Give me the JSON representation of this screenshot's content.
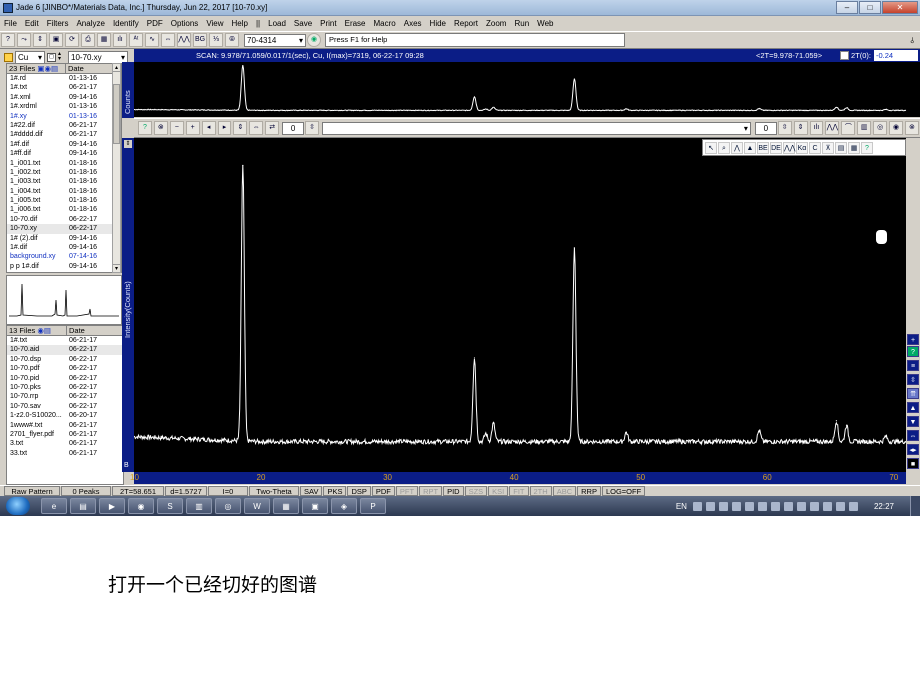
{
  "window": {
    "title": "Jade 6 [JINBO*/Materials Data, Inc.] Thursday, Jun 22, 2017 [10-70.xy]",
    "min": "–",
    "max": "□",
    "close": "✕"
  },
  "menu": [
    "File",
    "Edit",
    "Filters",
    "Analyze",
    "Identify",
    "PDF",
    "Options",
    "View",
    "Help",
    "||",
    "Load",
    "Save",
    "Print",
    "Erase",
    "Macro",
    "Axes",
    "Hide",
    "Report",
    "Zoom",
    "Run",
    "Web"
  ],
  "toolbar": {
    "pdf_number": "70-4314",
    "help_text": "Press F1 for Help",
    "buttons": [
      "?",
      "⤳",
      "⇕",
      "▣",
      "⟳",
      "⎙",
      "▦",
      "ılı",
      "ᴬᵗ",
      "∿",
      "⇔",
      "⋀⋀",
      "BG",
      "⅓",
      "⦾"
    ]
  },
  "left": {
    "filter": "Cu",
    "current_file": "10-70.xy",
    "top_list": {
      "header_files": "23 Files",
      "header_date": "Date",
      "rows": [
        {
          "name": "1#.rd",
          "date": "01-13-16"
        },
        {
          "name": "1#.txt",
          "date": "06-21-17"
        },
        {
          "name": "1#.xml",
          "date": "09-14-16"
        },
        {
          "name": "1#.xrdml",
          "date": "01-13-16"
        },
        {
          "name": "1#.xy",
          "date": "01-13-16",
          "blue": true
        },
        {
          "name": "1#22.dif",
          "date": "06-21-17"
        },
        {
          "name": "1#dddd.dif",
          "date": "06-21-17"
        },
        {
          "name": "1#f.dif",
          "date": "09-14-16"
        },
        {
          "name": "1#ff.dif",
          "date": "09-14-16"
        },
        {
          "name": "1_i001.txt",
          "date": "01-18-16"
        },
        {
          "name": "1_i002.txt",
          "date": "01-18-16"
        },
        {
          "name": "1_i003.txt",
          "date": "01-18-16"
        },
        {
          "name": "1_i004.txt",
          "date": "01-18-16"
        },
        {
          "name": "1_i005.txt",
          "date": "01-18-16"
        },
        {
          "name": "1_i006.txt",
          "date": "01-18-16"
        },
        {
          "name": "10-70.dif",
          "date": "06-22-17"
        },
        {
          "name": "10-70.xy",
          "date": "06-22-17",
          "selected": true
        },
        {
          "name": "1# (2).dif",
          "date": "09-14-16"
        },
        {
          "name": "1#.dif",
          "date": "09-14-16"
        },
        {
          "name": "background.xy",
          "date": "07-14-16",
          "blue": true
        },
        {
          "name": "p p 1#.dif",
          "date": "09-14-16"
        }
      ]
    },
    "bottom_list": {
      "header_files": "13 Files",
      "header_date": "Date",
      "rows": [
        {
          "name": "1#.txt",
          "date": "06-21-17"
        },
        {
          "name": "10-70.aid",
          "date": "06-22-17",
          "selected": true
        },
        {
          "name": "10-70.dsp",
          "date": "06-22-17"
        },
        {
          "name": "10-70.pdf",
          "date": "06-22-17"
        },
        {
          "name": "10-70.pid",
          "date": "06-22-17"
        },
        {
          "name": "10-70.pks",
          "date": "06-22-17"
        },
        {
          "name": "10-70.rrp",
          "date": "06-22-17"
        },
        {
          "name": "10-70.sav",
          "date": "06-22-17"
        },
        {
          "name": "1-z2.0-S10020...",
          "date": "06-20-17"
        },
        {
          "name": "1www#.txt",
          "date": "06-21-17"
        },
        {
          "name": "2701_flyer.pdf",
          "date": "06-21-17"
        },
        {
          "name": "3.txt",
          "date": "06-21-17"
        },
        {
          "name": "33.txt",
          "date": "06-21-17"
        }
      ]
    }
  },
  "scan": {
    "info": "SCAN: 9.978/71.059/0.017/1(sec), Cu, I(max)=7319, 06-22-17 09:28",
    "range": "<2T=9.978-71.059>",
    "two_theta0_label": "2T(0):",
    "two_theta0_value": "-0.24"
  },
  "toolbar2": {
    "spin_value": "0",
    "spin_value2": "0"
  },
  "plot": {
    "overview_ylabel": "Counts",
    "main_ylabel": "Intensity(Counts)",
    "xlabel_icon": "B"
  },
  "chart_data": {
    "type": "line",
    "xlabel": "",
    "ylabel": "Intensity(Counts)",
    "xlim": [
      10,
      71
    ],
    "ylim": [
      0,
      7800
    ],
    "ticks": [
      10,
      20,
      30,
      40,
      50,
      60,
      70
    ],
    "baseline": 550,
    "peaks": [
      {
        "x": 18.6,
        "y": 7319
      },
      {
        "x": 36.9,
        "y": 2600
      },
      {
        "x": 37.8,
        "y": 750
      },
      {
        "x": 38.4,
        "y": 1000
      },
      {
        "x": 44.8,
        "y": 5300
      },
      {
        "x": 48.9,
        "y": 780
      },
      {
        "x": 59.4,
        "y": 820
      },
      {
        "x": 65.5,
        "y": 1060
      },
      {
        "x": 66.3,
        "y": 950
      },
      {
        "x": 69.4,
        "y": 680
      }
    ]
  },
  "status": {
    "items": [
      {
        "text": "Raw Pattern"
      },
      {
        "text": "0 Peaks"
      },
      {
        "text": "2T=58.651"
      },
      {
        "text": "d=1.5727"
      },
      {
        "text": "I=0"
      },
      {
        "text": "Two-Theta"
      },
      {
        "text": "SAV"
      },
      {
        "text": "PKS"
      },
      {
        "text": "DSP"
      },
      {
        "text": "PDF"
      },
      {
        "text": "PFT",
        "dim": true
      },
      {
        "text": "RPT",
        "dim": true
      },
      {
        "text": "PID"
      },
      {
        "text": "SZS",
        "dim": true
      },
      {
        "text": "KSI",
        "dim": true
      },
      {
        "text": "FIT",
        "dim": true
      },
      {
        "text": "2TH",
        "dim": true
      },
      {
        "text": "ABC",
        "dim": true
      },
      {
        "text": "RRP"
      },
      {
        "text": "LOG=OFF"
      }
    ]
  },
  "taskbar": {
    "lang": "EN",
    "clock": "22:27",
    "apps": [
      "e",
      "▤",
      "▶",
      "◉",
      "S",
      "▥",
      "◎",
      "W",
      "▦",
      "▣",
      "◈",
      "P"
    ]
  },
  "caption": "打开一个已经切好的图谱"
}
